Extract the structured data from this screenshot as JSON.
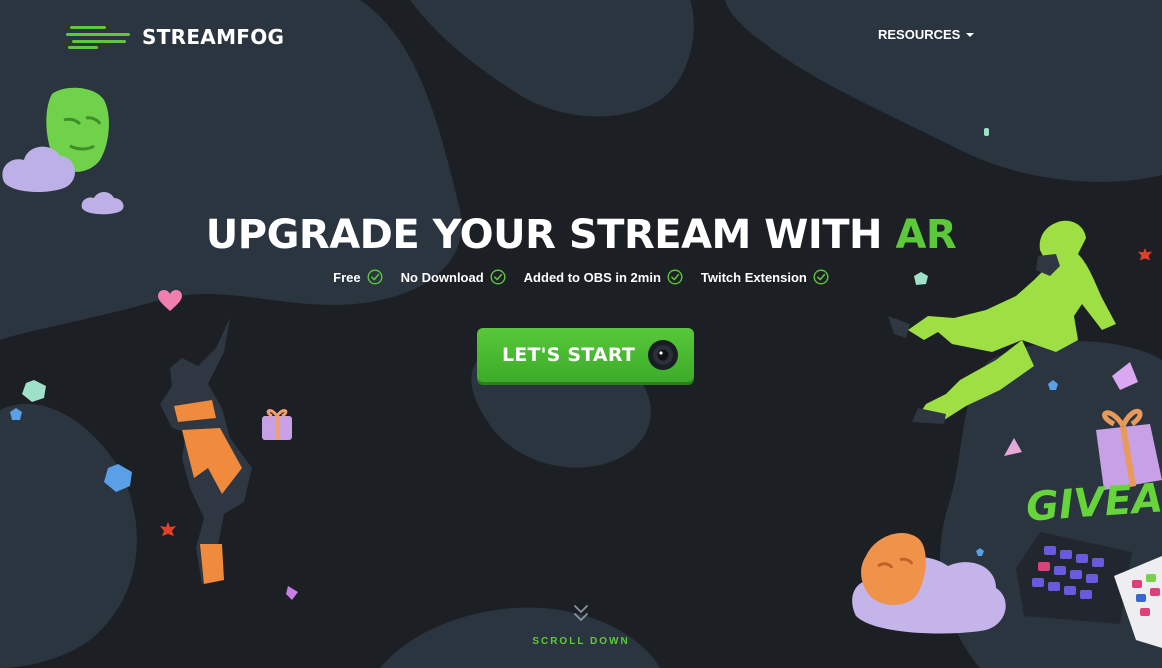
{
  "brand": {
    "name": "STREAMFOG",
    "logo_icon": "speed-lines-icon"
  },
  "nav": {
    "resources_label": "RESOURCES",
    "resources_icon": "caret-down-icon"
  },
  "hero": {
    "title_main": "UPGRADE YOUR STREAM WITH ",
    "title_accent": "AR",
    "features": [
      {
        "label": "Free",
        "icon": "check-circle-icon"
      },
      {
        "label": "No Download",
        "icon": "check-circle-icon"
      },
      {
        "label": "Added to OBS in 2min",
        "icon": "check-circle-icon"
      },
      {
        "label": "Twitch Extension",
        "icon": "check-circle-icon"
      }
    ],
    "cta_label": "LET'S START",
    "cta_icon": "camera-lens-icon"
  },
  "scroll": {
    "label": "SCROLL DOWN",
    "icon": "double-chevron-down-icon"
  },
  "promo": {
    "giveaway_text": "GIVEA"
  },
  "colors": {
    "background": "#1c1f24",
    "blob": "#2b3540",
    "accent": "#5cc93a"
  }
}
